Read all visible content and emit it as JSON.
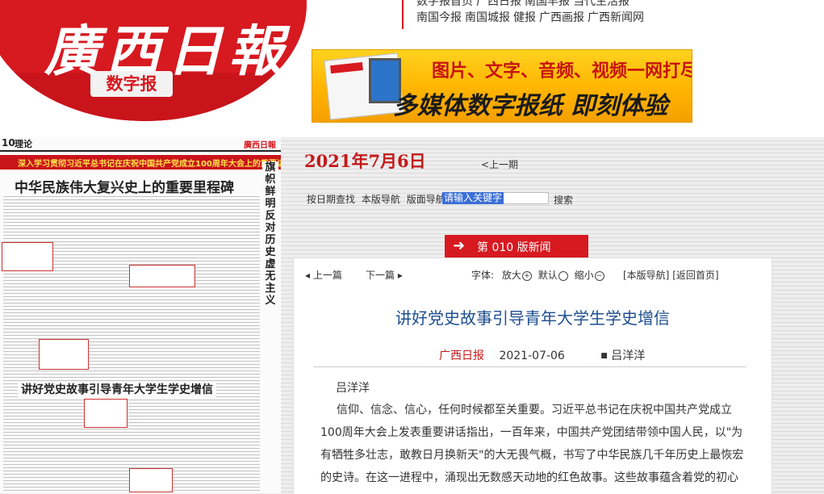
{
  "header": {
    "logo_title": "廣西日報",
    "logo_sub": "数字报",
    "nav_row1": [
      "数字报首页",
      "广西日报",
      "南国早报",
      "当代生活报"
    ],
    "nav_row2": [
      "南国今报",
      "南国城报",
      "健报",
      "广西画报",
      "广西新闻网"
    ]
  },
  "banner": {
    "line1": "图片、文字、音频、视频一网打尽!",
    "line2": "多媒体数字报纸  即刻体验"
  },
  "thumbnail": {
    "page_no": "10",
    "column": "理论",
    "brand": "廣西日報",
    "red_banner": "深入学习贯彻习近平总书记在庆祝中国共产党成立100周年大会上的重要讲话精神",
    "headline": "中华民族伟大复兴史上的重要里程碑",
    "vertical_title": "旗帜鲜明反对历史虚无主义",
    "sub_headline": "讲好党史故事引导青年大学生学史增信"
  },
  "date": "2021年7月6日",
  "prev_day": "<上一期",
  "search": {
    "date_search": "按日期查找",
    "edition_nav": "本版导航",
    "layout_nav": "版面导航",
    "placeholder": "请输入关键字",
    "button": "搜索"
  },
  "section": {
    "label": "第 010 版新闻"
  },
  "toolbar": {
    "prev_article": "上一篇",
    "next_article": "下一篇",
    "font_label": "字体:",
    "bigger": "放大",
    "default": "默认",
    "smaller": "缩小",
    "edition_nav": "[本版导航]",
    "home": "[返回首页]"
  },
  "article": {
    "title": "讲好党史故事引导青年大学生学史增信",
    "source": "广西日报",
    "date": "2021-07-06",
    "author_meta": "吕洋洋",
    "author": "吕洋洋",
    "body": "信仰、信念、信心，任何时候都至关重要。习近平总书记在庆祝中国共产党成立100周年大会上发表重要讲话指出，一百年来，中国共产党团结带领中国人民，以\"为有牺牲多壮志，敢教日月换新天\"的大无畏气概，书写了中华民族几千年历史上最恢宏的史诗。在这一进程中，涌现出无数感天动地的红色故事。这些故事蕴含着党的初心"
  }
}
